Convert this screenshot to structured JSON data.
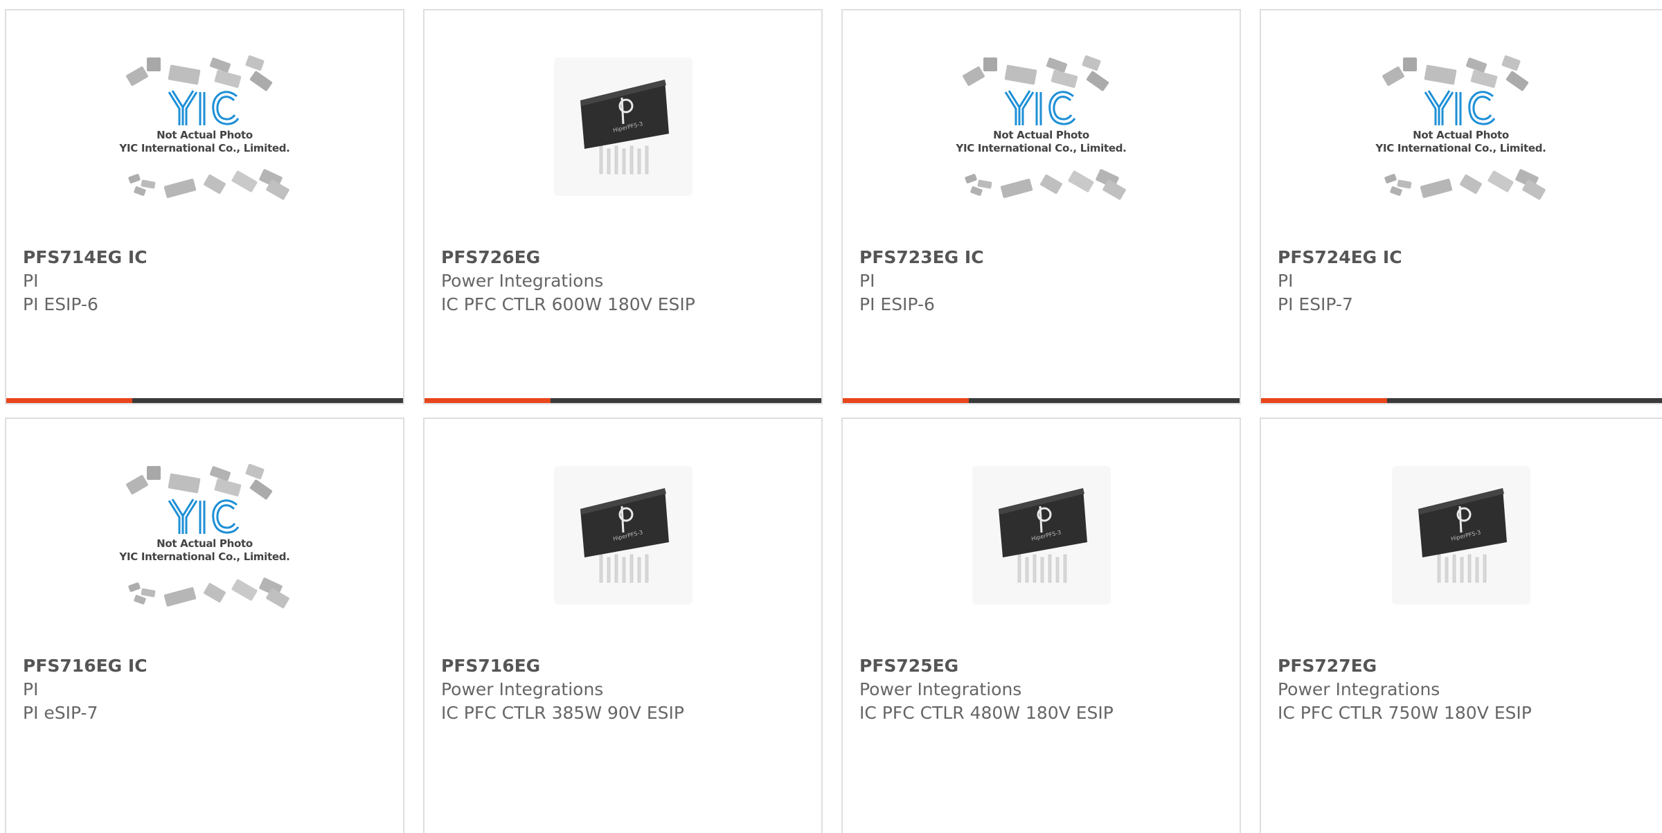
{
  "placeholder": {
    "line1": "Not Actual Photo",
    "line2": "YIC International Co., Limited."
  },
  "colors": {
    "accent": "#e8461b",
    "bar": "#3a3a3a",
    "border": "#dedede",
    "logo_blue": "#1d8fd6"
  },
  "products": [
    {
      "name": "PFS714EG IC",
      "brand": "PI",
      "desc": "PI ESIP-6",
      "image": "yic-placeholder"
    },
    {
      "name": "PFS726EG",
      "brand": "Power Integrations",
      "desc": "IC PFC CTLR 600W 180V ESIP",
      "image": "chip-photo"
    },
    {
      "name": "PFS723EG IC",
      "brand": "PI",
      "desc": "PI ESIP-6",
      "image": "yic-placeholder"
    },
    {
      "name": "PFS724EG IC",
      "brand": "PI",
      "desc": "PI ESIP-7",
      "image": "yic-placeholder"
    },
    {
      "name": "PFS716EG IC",
      "brand": "PI",
      "desc": "PI eSIP-7",
      "image": "yic-placeholder"
    },
    {
      "name": "PFS716EG",
      "brand": "Power Integrations",
      "desc": "IC PFC CTLR 385W 90V ESIP",
      "image": "chip-photo"
    },
    {
      "name": "PFS725EG",
      "brand": "Power Integrations",
      "desc": "IC PFC CTLR 480W 180V ESIP",
      "image": "chip-photo"
    },
    {
      "name": "PFS727EG",
      "brand": "Power Integrations",
      "desc": "IC PFC CTLR 750W 180V ESIP",
      "image": "chip-photo"
    }
  ]
}
